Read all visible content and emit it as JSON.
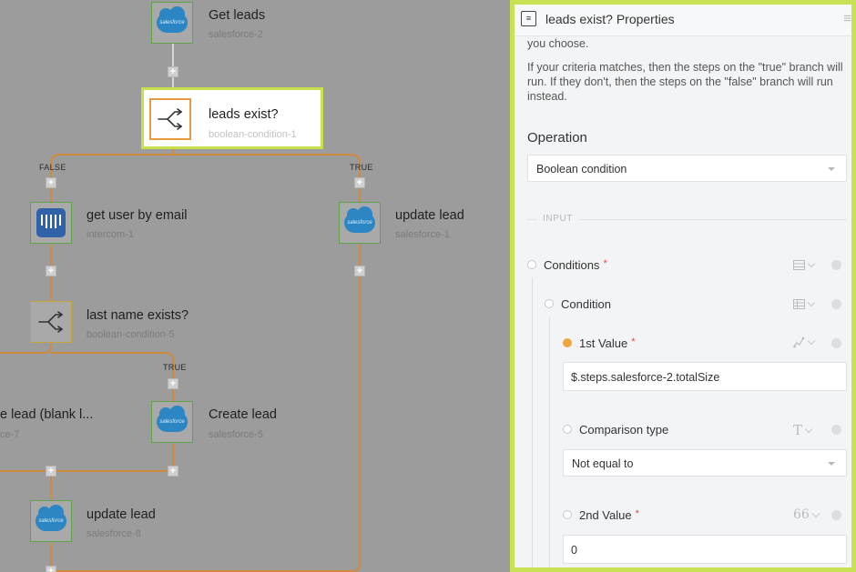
{
  "colors": {
    "accent": "#c8e04a",
    "salesforce": "#2d86c4",
    "intercom": "#2f62a8",
    "wire": "#d08a3c",
    "condition": "#e89a3e"
  },
  "canvas": {
    "nodes": [
      {
        "title": "Get leads",
        "subtitle": "salesforce-2",
        "icon": "salesforce-logo-icon"
      },
      {
        "title": "leads exist?",
        "subtitle": "boolean-condition-1",
        "icon": "branch-split-icon",
        "selected": true
      },
      {
        "title": "get user by email",
        "subtitle": "intercom-1",
        "icon": "intercom-logo-icon"
      },
      {
        "title": "update lead",
        "subtitle": "salesforce-1",
        "icon": "salesforce-logo-icon"
      },
      {
        "title": "last name exists?",
        "subtitle": "boolean-condition-5",
        "icon": "branch-split-icon"
      },
      {
        "title": "e lead (blank l...",
        "subtitle": "ce-7",
        "icon": "salesforce-logo-icon"
      },
      {
        "title": "Create lead",
        "subtitle": "salesforce-5",
        "icon": "salesforce-logo-icon"
      },
      {
        "title": "update lead",
        "subtitle": "salesforce-8",
        "icon": "salesforce-logo-icon"
      }
    ],
    "branch_labels": {
      "false": "FALSE",
      "true": "TRUE"
    },
    "salesforce_logo_text": "salesforce"
  },
  "panel": {
    "title": "leads exist? Properties",
    "description_1": "you choose.",
    "description_2": "If your criteria matches, then the steps on the \"true\" branch will run. If they don't, then the steps on the \"false\" branch will run instead.",
    "operation_label": "Operation",
    "operation_value": "Boolean condition",
    "input_label": "INPUT",
    "conditions_label": "Conditions",
    "condition_label": "Condition",
    "first_value_label": "1st Value",
    "first_value": "$.steps.salesforce-2.totalSize",
    "comparison_label": "Comparison type",
    "comparison_value": "Not equal to",
    "second_value_label": "2nd Value",
    "second_value": "0",
    "required_mark": "*"
  }
}
